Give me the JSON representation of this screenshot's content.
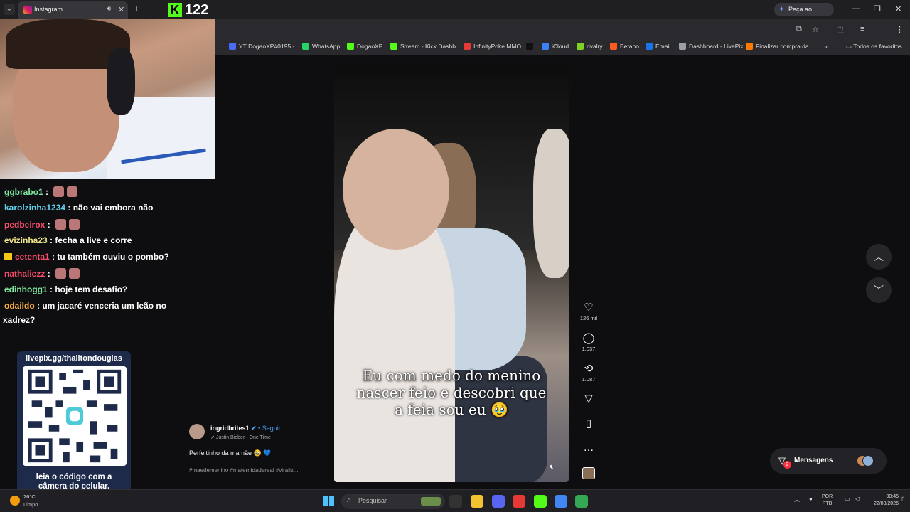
{
  "browser": {
    "tab_title": "Instagram",
    "new_tab": "+",
    "gemini_label": "Peça ao Gemini",
    "bookmarks": [
      {
        "label": "YT DogaoXP#0195 -...",
        "color": "#4a6cf7"
      },
      {
        "label": "WhatsApp",
        "color": "#25d366"
      },
      {
        "label": "DogaoXP",
        "color": "#53fc18"
      },
      {
        "label": "Stream - Kick Dashb...",
        "color": "#53fc18"
      },
      {
        "label": "InfinityPoke MMO",
        "color": "#e53935"
      },
      {
        "label": "",
        "color": "#111111"
      },
      {
        "label": "iCloud",
        "color": "#3b82f6"
      },
      {
        "label": "rivalry",
        "color": "#7ed321"
      },
      {
        "label": "Betano",
        "color": "#ff5a1f"
      },
      {
        "label": "Email",
        "color": "#1a73e8"
      },
      {
        "label": "Dashboard - LivePix",
        "color": "#9aa0a6"
      },
      {
        "label": "Finalizar compra da...",
        "color": "#ff7a00"
      }
    ],
    "bookmarks_overflow": "»",
    "all_favorites": "Todos os favoritos"
  },
  "stream": {
    "viewer_count": "122",
    "chat": [
      {
        "user": "ggbrabo1",
        "color": "#7ee8a0",
        "text": "",
        "emotes": 2,
        "crown": false
      },
      {
        "user": "karolzinha1234",
        "color": "#5fd3f0",
        "text": "não vai embora não",
        "emotes": 0,
        "crown": false
      },
      {
        "user": "pedbeirox",
        "color": "#ff4d6d",
        "text": "",
        "emotes": 2,
        "crown": false
      },
      {
        "user": "evizinha23",
        "color": "#f0e68c",
        "text": "fecha a live e corre",
        "emotes": 0,
        "crown": false
      },
      {
        "user": "cetenta1",
        "color": "#ff4d6d",
        "text": "tu também ouviu o pombo?",
        "emotes": 0,
        "crown": true
      },
      {
        "user": "nathaliezz",
        "color": "#ff4d6d",
        "text": "",
        "emotes": 2,
        "crown": false
      },
      {
        "user": "edinhogg1",
        "color": "#7ee8a0",
        "text": "hoje tem desafio?",
        "emotes": 0,
        "crown": false
      },
      {
        "user": "odaildo",
        "color": "#ffb347",
        "text": "um jacaré venceria um leão no",
        "emotes": 0,
        "crown": false
      }
    ],
    "chat_wrap": "xadrez?",
    "qr_url": "livepix.gg/thalitondouglas",
    "qr_caption_1": "leia o código com a",
    "qr_caption_2": "câmera do celular."
  },
  "reel": {
    "caption_1": "Eu com medo do menino",
    "caption_2": "nascer feio e descobri que",
    "caption_3": "a feia sou eu 🥹",
    "author": "ingridbrites1",
    "follow": "Seguir",
    "audio": "Justin Bieber · One Time",
    "post_text": "Perfeitinho da mamãe 🥹 💙",
    "hashtags": "#maedemenino #maternidadereal #viraliz...",
    "likes": "126 mil",
    "comments": "1.037",
    "reposts": "1.087"
  },
  "messages": {
    "label": "Mensagens",
    "badge": "2"
  },
  "taskbar": {
    "weather_temp": "26°C",
    "weather_desc": "Limpo",
    "search_placeholder": "Pesquisar",
    "lang_1": "POR",
    "lang_2": "PTB",
    "time": "00:45",
    "date": "22/08/2026"
  }
}
